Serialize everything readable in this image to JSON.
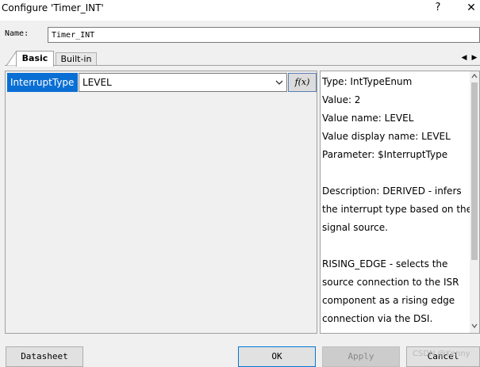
{
  "window": {
    "title": "Configure 'Timer_INT'",
    "help_glyph": "?",
    "close_glyph": "✕"
  },
  "name_field": {
    "label": "Name:",
    "value": "Timer_INT"
  },
  "tabs": [
    {
      "label": "Basic",
      "active": true
    },
    {
      "label": "Built-in",
      "active": false
    }
  ],
  "tab_scroll": {
    "left": "◀",
    "right": "▶"
  },
  "parameter": {
    "name": "InterruptType",
    "value": "LEVEL",
    "fx_label": "f(x)"
  },
  "description": {
    "lines": [
      "Type: IntTypeEnum",
      "Value: 2",
      "Value name: LEVEL",
      "Value display name: LEVEL",
      "Parameter: $InterruptType",
      "",
      "Description: DERIVED - infers",
      "the interrupt type based on the",
      "signal source.",
      "",
      "RISING_EDGE - selects the",
      "source connection to the ISR",
      "component as a rising edge",
      "connection via the DSI."
    ]
  },
  "buttons": {
    "datasheet": "Datasheet",
    "ok": "OK",
    "apply": "Apply",
    "cancel": "Cancel"
  },
  "watermark": "CSDN @Kenny",
  "colors": {
    "selection": "#0a6fd4",
    "ok_border": "#0078d7"
  }
}
